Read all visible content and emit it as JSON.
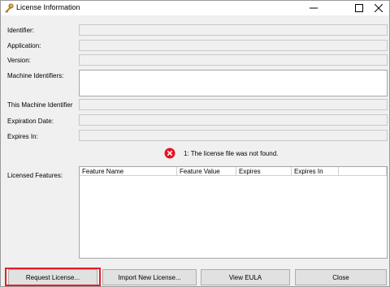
{
  "window": {
    "title": "License Information",
    "icons": {
      "app": "key-icon",
      "minimize": "minimize-icon",
      "maximize": "maximize-icon",
      "close": "close-icon"
    }
  },
  "fields": {
    "identifier": {
      "label": "Identifier:",
      "value": ""
    },
    "application": {
      "label": "Application:",
      "value": ""
    },
    "version": {
      "label": "Version:",
      "value": ""
    },
    "machine_identifiers": {
      "label": "Machine Identifiers:",
      "value": ""
    },
    "this_machine_identifier": {
      "label": "This Machine Identifier",
      "value": ""
    },
    "expiration_date": {
      "label": "Expiration Date:",
      "value": ""
    },
    "expires_in": {
      "label": "Expires In:",
      "value": ""
    }
  },
  "status": {
    "icon": "error-icon",
    "message": "1: The license file was not found.",
    "color": "#e81123"
  },
  "features": {
    "label": "Licensed Features:",
    "columns": [
      "Feature Name",
      "Feature Value",
      "Expires",
      "Expires In"
    ],
    "rows": []
  },
  "buttons": {
    "request": "Request License...",
    "import": "Import New License...",
    "eula": "View EULA",
    "close": "Close"
  },
  "highlight_color": "#e0202a"
}
